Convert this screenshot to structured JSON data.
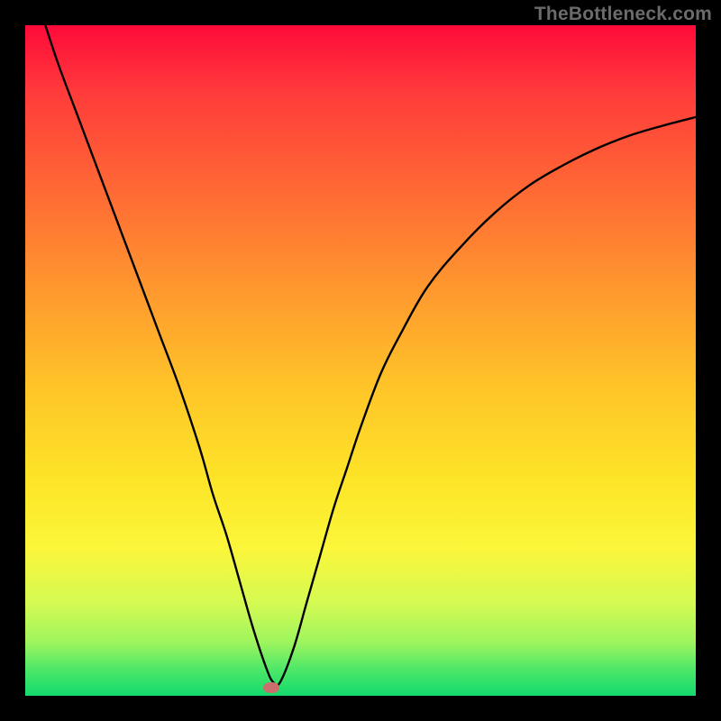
{
  "watermark": "TheBottleneck.com",
  "chart_data": {
    "type": "line",
    "title": "",
    "xlabel": "",
    "ylabel": "",
    "xlim": [
      0,
      100
    ],
    "ylim": [
      0,
      100
    ],
    "grid": false,
    "series": [
      {
        "name": "curve",
        "x": [
          3,
          5,
          8,
          11,
          14,
          17,
          20,
          23,
          26,
          28,
          30,
          32,
          34,
          36,
          37,
          38,
          40,
          42,
          44,
          46,
          48,
          50,
          53,
          56,
          60,
          65,
          70,
          75,
          80,
          85,
          90,
          95,
          100
        ],
        "y": [
          100,
          94,
          86,
          78,
          70,
          62,
          54,
          46,
          37,
          30,
          24,
          17,
          10,
          4,
          2,
          2,
          7,
          14,
          21,
          28,
          34,
          40,
          48,
          54,
          61,
          67,
          72,
          76,
          79,
          81.5,
          83.5,
          85,
          86.3
        ]
      }
    ],
    "marker": {
      "x": 36.7,
      "y": 1.2,
      "color": "#cb6e6e"
    },
    "background_gradient": {
      "direction": "top-to-bottom",
      "stops": [
        {
          "pos": 0,
          "color": "#ff0a3a"
        },
        {
          "pos": 10,
          "color": "#ff3b3b"
        },
        {
          "pos": 25,
          "color": "#ff6a34"
        },
        {
          "pos": 40,
          "color": "#ff9a2e"
        },
        {
          "pos": 55,
          "color": "#ffc728"
        },
        {
          "pos": 68,
          "color": "#fde528"
        },
        {
          "pos": 78,
          "color": "#fbf63a"
        },
        {
          "pos": 86,
          "color": "#d6fa52"
        },
        {
          "pos": 92,
          "color": "#9ef55e"
        },
        {
          "pos": 96,
          "color": "#4fe768"
        },
        {
          "pos": 100,
          "color": "#13db6e"
        }
      ]
    }
  }
}
